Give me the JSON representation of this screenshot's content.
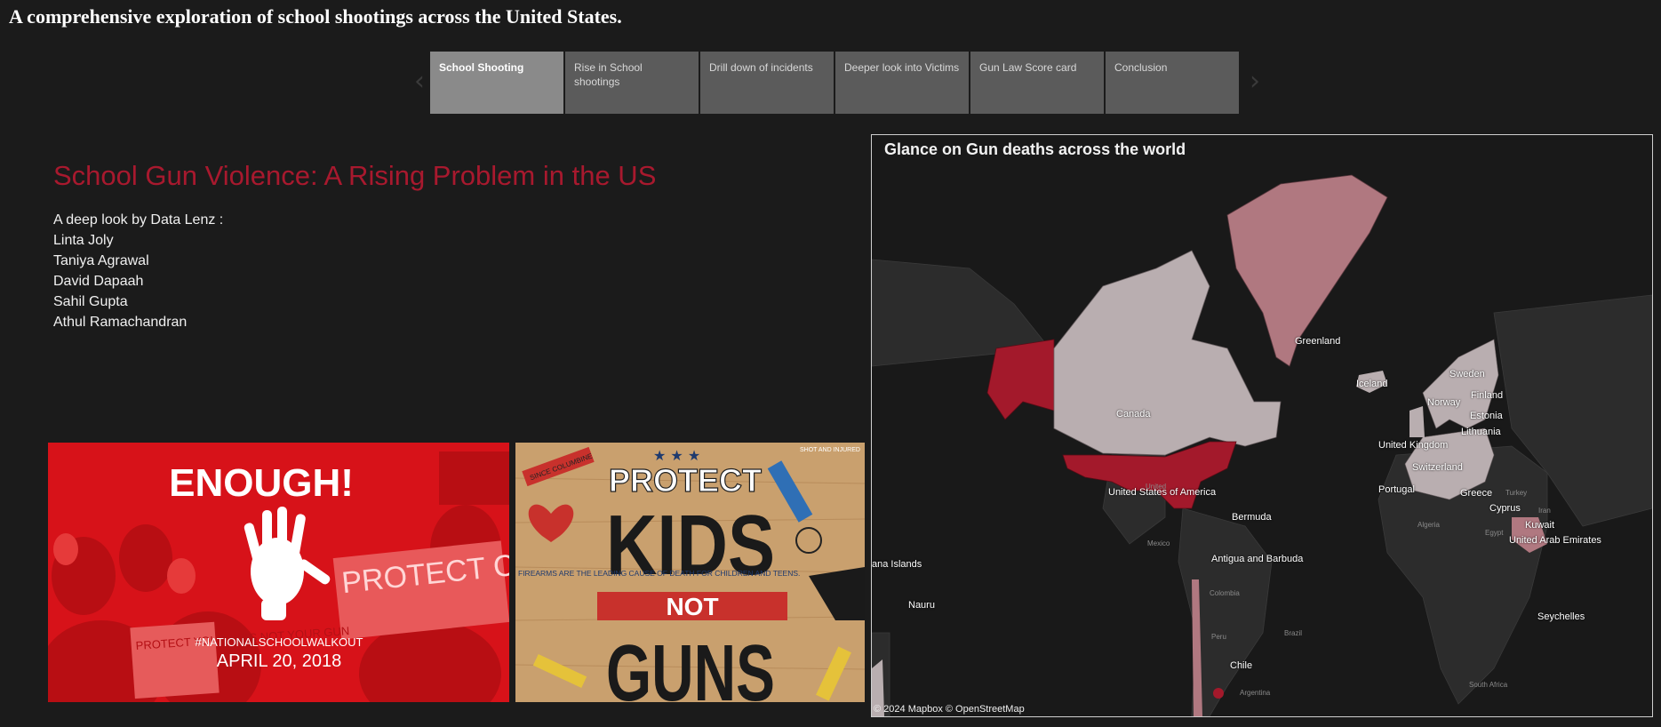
{
  "page_title": "A comprehensive exploration of school shootings across the United States.",
  "nav": {
    "prev_icon": "chevron-left-icon",
    "next_icon": "chevron-right-icon",
    "tabs": [
      {
        "label": "School Shooting",
        "active": true
      },
      {
        "label": "Rise in School shootings",
        "active": false
      },
      {
        "label": "Drill down of incidents",
        "active": false
      },
      {
        "label": "Deeper look into Victims",
        "active": false
      },
      {
        "label": "Gun Law Score card",
        "active": false
      },
      {
        "label": "Conclusion",
        "active": false
      }
    ]
  },
  "heading": "School Gun Violence: A Rising Problem in the US",
  "credits": {
    "intro": "A deep look by Data Lenz :",
    "authors": [
      "Linta Joly",
      "Taniya Agrawal",
      "David Dapaah",
      "Sahil Gupta",
      "Athul Ramachandran"
    ]
  },
  "poster1": {
    "headline": "ENOUGH!",
    "hashtag": "#NATIONALSCHOOLWALKOUT",
    "date": "APRIL 20, 2018",
    "sign_text": "PROTECT CHILDREN NOT GUNS",
    "side_sign": "PROTECT YOUR KIDS NOT YOUR GUN"
  },
  "poster2": {
    "line1": "PROTECT",
    "line2": "KIDS",
    "line3": "NOT",
    "line4": "GUNS",
    "side_text": "FIREARMS ARE THE LEADING CAUSE OF DEATH FOR CHILDREN AND TEENS.",
    "corner_text": "SHOT AND INJURED",
    "crayon_text": "SINCE COLUMBINE"
  },
  "map": {
    "title": "Glance on Gun deaths across the world",
    "attribution": "© 2024 Mapbox  © OpenStreetMap",
    "countries": [
      "Greenland",
      "Iceland",
      "Sweden",
      "Finland",
      "Norway",
      "Estonia",
      "Lithuania",
      "Canada",
      "United Kingdom",
      "Switzerland",
      "Portugal",
      "Greece",
      "United States of America",
      "Cyprus",
      "Bermuda",
      "Kuwait",
      "United Arab Emirates",
      "ana Islands",
      "Antigua and Barbuda",
      "Nauru",
      "Seychelles",
      "Chile"
    ],
    "basemap_labels": [
      "United",
      "Mexico",
      "Colombia",
      "Peru",
      "Brazil",
      "Argentina",
      "Algeria",
      "Egypt",
      "Turkey",
      "Iran",
      "South Africa"
    ],
    "colors": {
      "high": "#a3192b",
      "medium": "#b07880",
      "low": "#b9aeb0",
      "land": "#2c2c2c"
    }
  }
}
